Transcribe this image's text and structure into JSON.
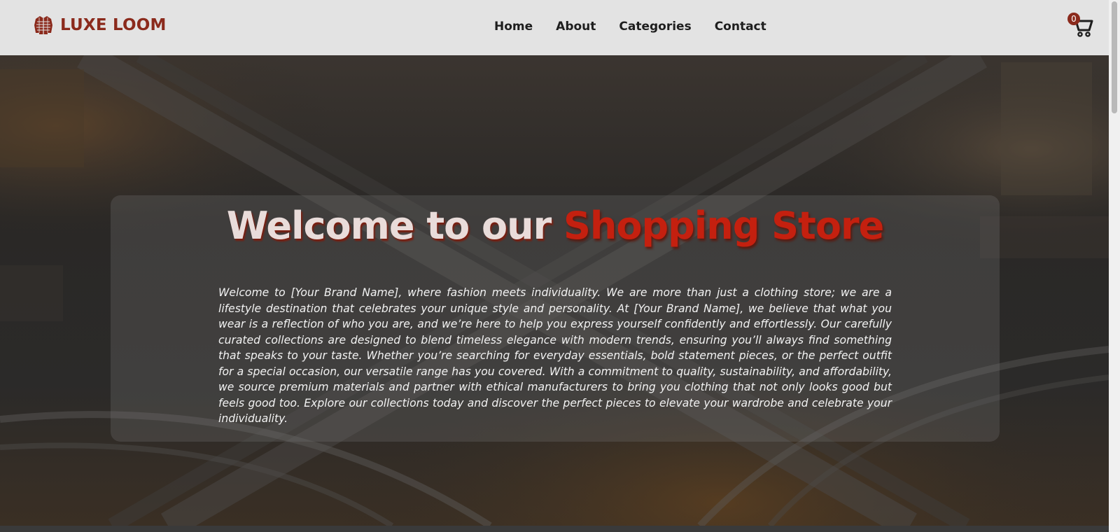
{
  "brand": {
    "name": "LUXE LOOM",
    "logo_icon": "jacket-icon",
    "color": "#8b2a1c"
  },
  "nav": {
    "items": [
      {
        "label": "Home"
      },
      {
        "label": "About"
      },
      {
        "label": "Categories"
      },
      {
        "label": "Contact"
      }
    ]
  },
  "cart": {
    "icon": "shopping-cart-icon",
    "count": "0",
    "badge_color": "#8b2a1c"
  },
  "hero": {
    "headline_part1": "Welcome to our ",
    "headline_part2": "Shopping Store",
    "accent_color": "#c4200f",
    "intro": "Welcome to [Your Brand Name], where fashion meets individuality. We are more than just a clothing store; we are a lifestyle destination that celebrates your unique style and personality. At [Your Brand Name], we believe that what you wear is a reflection of who you are, and we’re here to help you express yourself confidently and effortlessly. Our carefully curated collections are designed to blend timeless elegance with modern trends, ensuring you’ll always find something that speaks to your taste. Whether you’re searching for everyday essentials, bold statement pieces, or the perfect outfit for a special occasion, our versatile range has you covered. With a commitment to quality, sustainability, and affordability, we source premium materials and partner with ethical manufacturers to bring you clothing that not only looks good but feels good too. Explore our collections today and discover the perfect pieces to elevate your wardrobe and celebrate your individuality."
  }
}
